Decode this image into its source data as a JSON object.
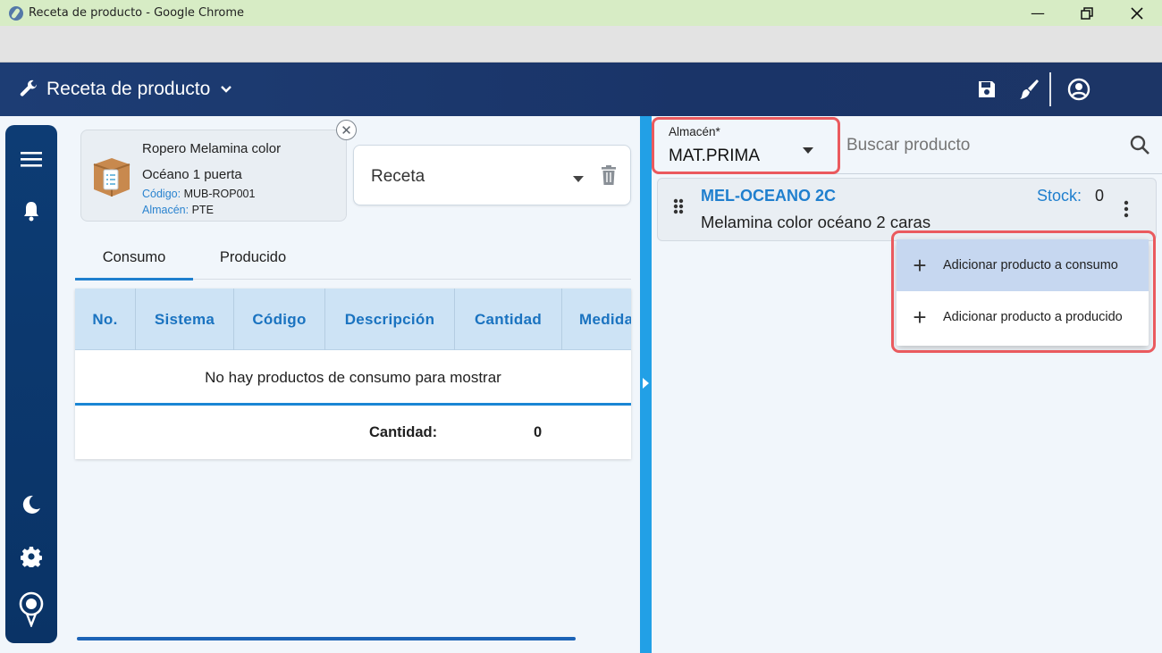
{
  "window": {
    "title": "Receta de producto - Google Chrome"
  },
  "app": {
    "title": "Receta de producto"
  },
  "product": {
    "name_line1": "Ropero Melamina color",
    "name_line2": "Océano 1 puerta",
    "code_label": "Código:",
    "code_value": "MUB-ROP001",
    "warehouse_label": "Almacén:",
    "warehouse_value": "PTE"
  },
  "receta": {
    "label": "Receta"
  },
  "tabs": [
    {
      "label": "Consumo"
    },
    {
      "label": "Producido"
    }
  ],
  "table": {
    "columns": [
      "No.",
      "Sistema",
      "Código",
      "Descripción",
      "Cantidad",
      "Medida"
    ],
    "empty_message": "No hay productos de consumo para mostrar",
    "footer_label": "Cantidad:",
    "footer_value": "0"
  },
  "almacen": {
    "label": "Almacén*",
    "value": "MAT.PRIMA"
  },
  "search": {
    "placeholder": "Buscar producto"
  },
  "result": {
    "code": "MEL-OCEANO 2C",
    "stock_label": "Stock:",
    "stock_value": "0",
    "description": "Melamina color océano 2 caras"
  },
  "menu": {
    "items": [
      {
        "label": "Adicionar producto a consumo"
      },
      {
        "label": "Adicionar producto a producido"
      }
    ]
  },
  "colors": {
    "app_bar": "#1d3d74",
    "accent": "#1f7fce",
    "highlight": "#ea5a5e",
    "rail": "#0d3c74"
  }
}
